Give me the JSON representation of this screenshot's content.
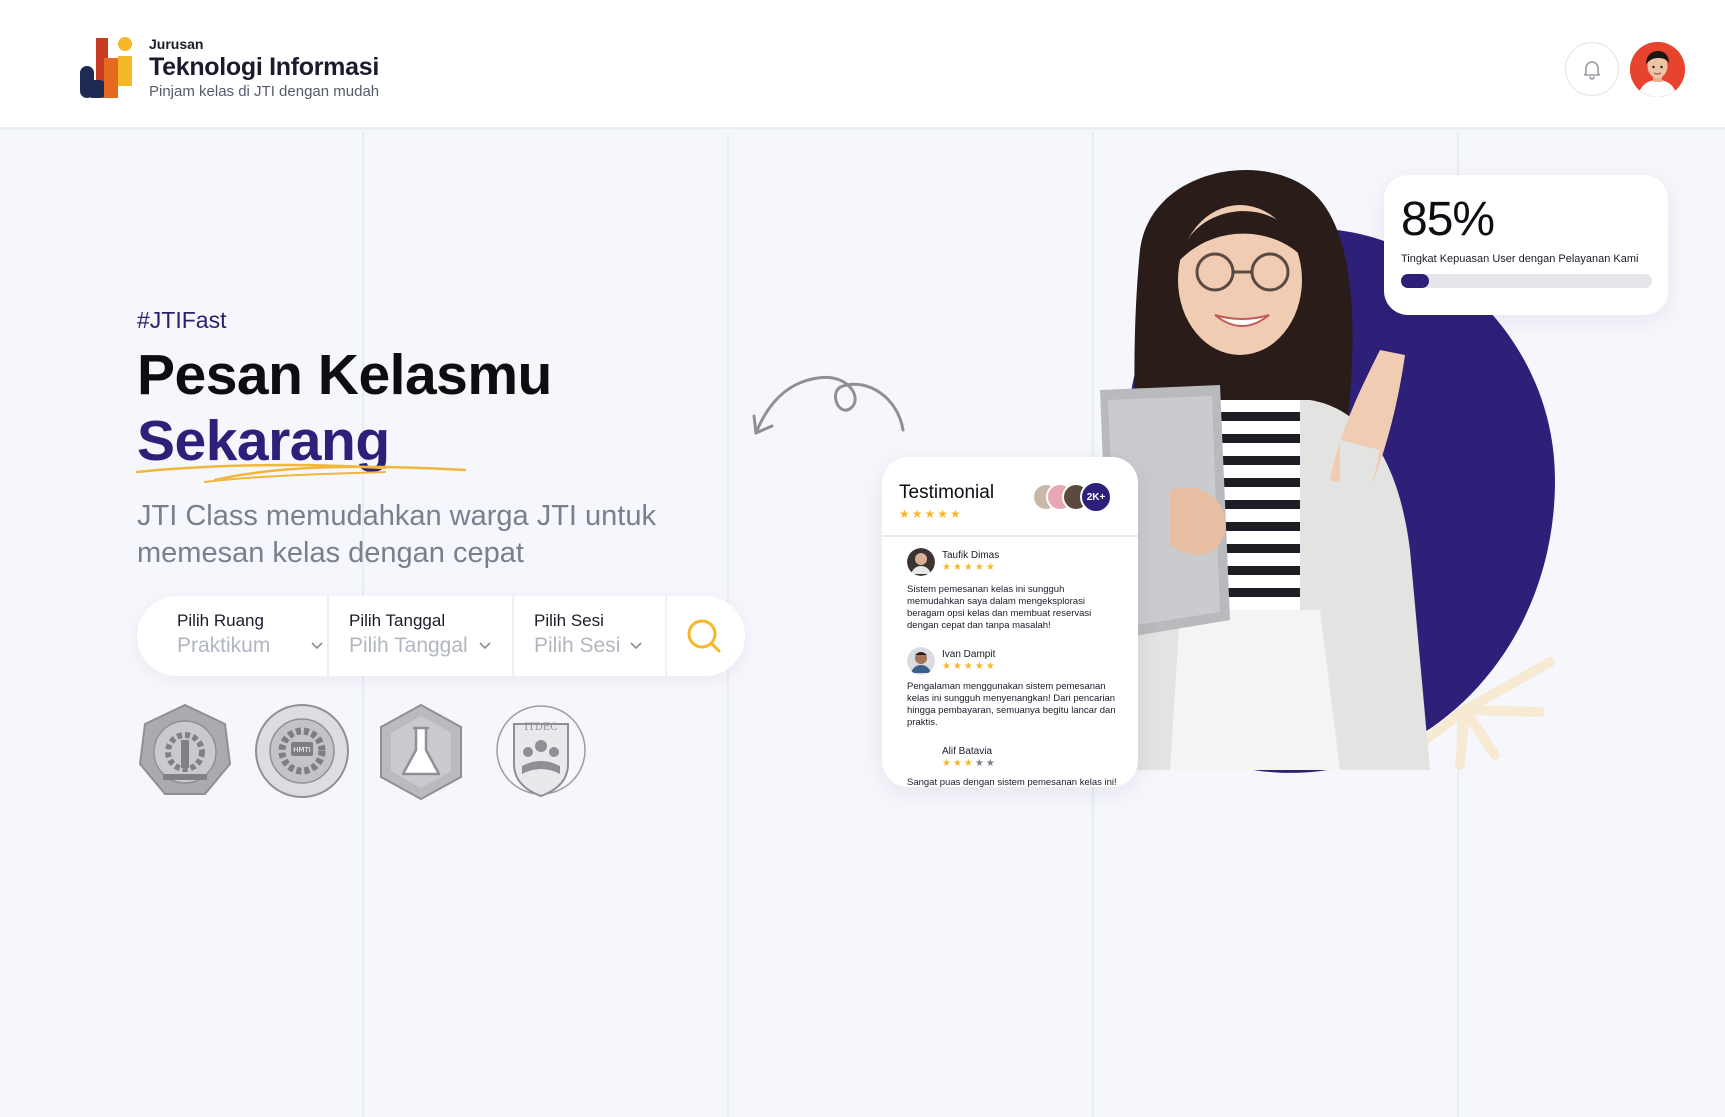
{
  "header": {
    "brand_small": "Jurusan",
    "brand_title": "Teknologi Informasi",
    "brand_tagline": "Pinjam kelas di JTI dengan mudah",
    "notification_icon": "bell-icon",
    "avatar": "user-avatar"
  },
  "hero": {
    "hashtag": "#JTIFast",
    "title_line1": "Pesan Kelasmu",
    "title_line2": "Sekarang",
    "subtitle": "JTI Class memudahkan warga JTI untuk memesan kelas dengan cepat"
  },
  "search": {
    "fields": [
      {
        "label": "Pilih Ruang",
        "value": "Praktikum"
      },
      {
        "label": "Pilih Tanggal",
        "value": "Pilih Tanggal"
      },
      {
        "label": "Pilih Sesi",
        "value": "Pilih Sesi"
      }
    ],
    "button_icon": "search-icon"
  },
  "partners": {
    "logos": [
      "polinema-logo",
      "hmti-logo",
      "lab-logo",
      "itdec-logo"
    ],
    "itdec_text": "ITDEC",
    "hmti_text": "HMTI"
  },
  "stat": {
    "value": "85%",
    "label": "Tingkat Kepuasan User dengan Pelayanan Kami",
    "progress_fraction": 0.11
  },
  "testimonial": {
    "title": "Testimonial",
    "count_badge": "2K+",
    "rating": 5,
    "reviews": [
      {
        "name": "Taufik Dimas",
        "rating": 5,
        "text": "Sistem pemesanan kelas ini sungguh memudahkan saya dalam mengeksplorasi beragam opsi kelas dan membuat reservasi dengan cepat dan tanpa masalah!"
      },
      {
        "name": "Ivan Dampit",
        "rating": 5,
        "text": "Pengalaman menggunakan sistem pemesanan kelas ini sungguh menyenangkan! Dari pencarian hingga pembayaran, semuanya begitu lancar dan praktis."
      },
      {
        "name": "Alif Batavia",
        "rating": 3,
        "text": "Sangat puas dengan sistem pemesanan kelas ini!"
      }
    ]
  },
  "colors": {
    "brand_purple": "#2e1f78",
    "accent_yellow": "#f4b829",
    "background": "#f6f7fc"
  }
}
